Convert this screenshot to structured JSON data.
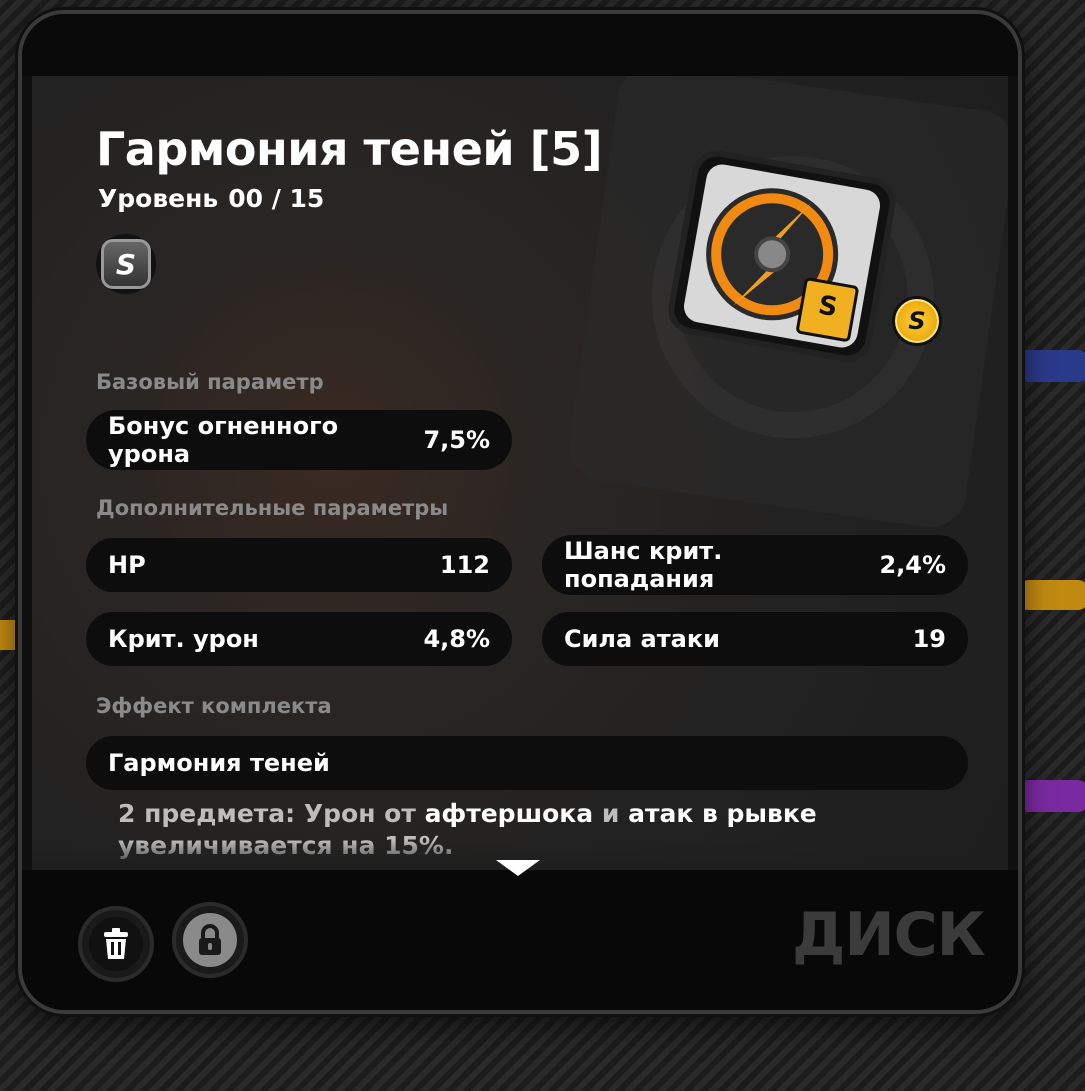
{
  "item": {
    "title": "Гармония теней [5]",
    "level_label": "Уровень",
    "level_value": "00 / 15",
    "rank": "S",
    "rarity": "S"
  },
  "base_section": {
    "header": "Базовый параметр",
    "stat": {
      "label": "Бонус огненного урона",
      "value": "7,5%"
    }
  },
  "extra_section": {
    "header": "Дополнительные параметры",
    "stats": [
      {
        "label": "HP",
        "value": "112"
      },
      {
        "label": "Шанс крит. попадания",
        "value": "2,4%"
      },
      {
        "label": "Крит. урон",
        "value": "4,8%"
      },
      {
        "label": "Сила атаки",
        "value": "19"
      }
    ]
  },
  "set_section": {
    "header": "Эффект комплекта",
    "name": "Гармония теней",
    "desc_prefix": "2 предмета: Урон от ",
    "desc_hl1": "афтершока",
    "desc_mid": " и ",
    "desc_hl2": "атак в рывке",
    "desc_suffix": " увеличивается на 15%."
  },
  "footer": {
    "category": "ДИСК"
  },
  "colors": {
    "accent_gold": "#e59a00",
    "panel_bg": "#222222",
    "muted_text": "#8a8a8a"
  },
  "icons": [
    "trash-icon",
    "lock-icon",
    "chevron-down-icon"
  ]
}
